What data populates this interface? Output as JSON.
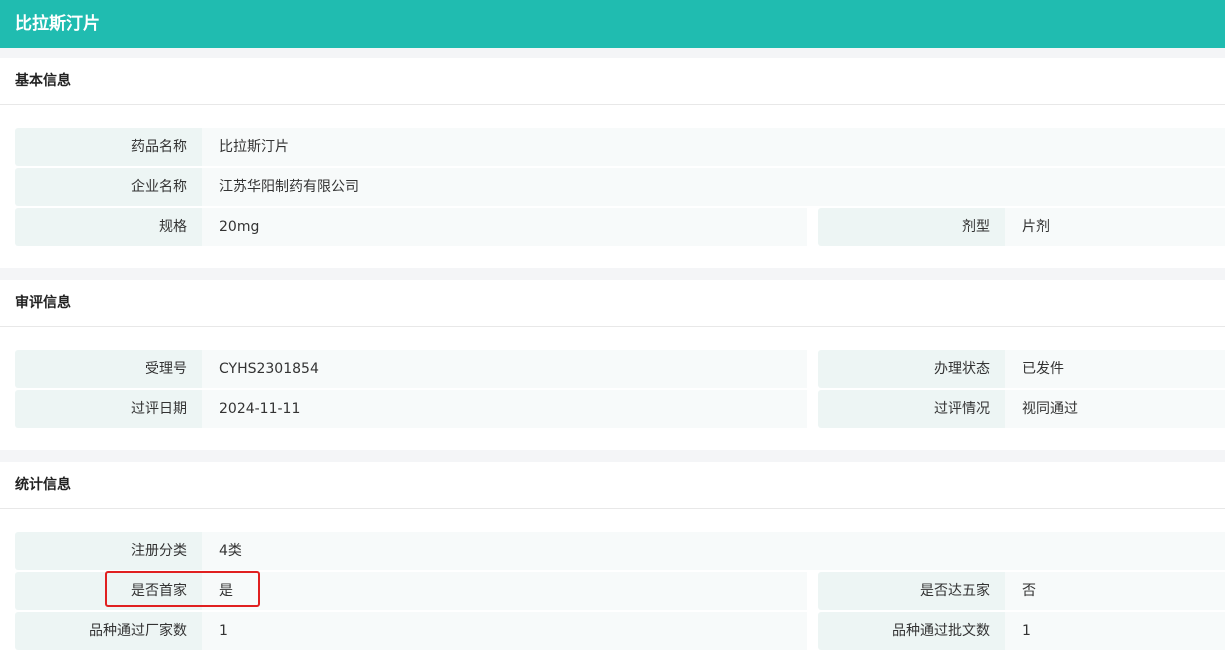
{
  "header": {
    "title": "比拉斯汀片"
  },
  "sections": [
    {
      "title": "基本信息",
      "rows": [
        [
          {
            "label": "药品名称",
            "value": "比拉斯汀片"
          }
        ],
        [
          {
            "label": "企业名称",
            "value": "江苏华阳制药有限公司"
          }
        ],
        [
          {
            "label": "规格",
            "value": "20mg"
          },
          {
            "label": "剂型",
            "value": "片剂"
          }
        ]
      ]
    },
    {
      "title": "审评信息",
      "rows": [
        [
          {
            "label": "受理号",
            "value": "CYHS2301854"
          },
          {
            "label": "办理状态",
            "value": "已发件"
          }
        ],
        [
          {
            "label": "过评日期",
            "value": "2024-11-11"
          },
          {
            "label": "过评情况",
            "value": "视同通过"
          }
        ]
      ]
    },
    {
      "title": "统计信息",
      "rows": [
        [
          {
            "label": "注册分类",
            "value": "4类"
          }
        ],
        [
          {
            "label": "是否首家",
            "value": "是"
          },
          {
            "label": "是否达五家",
            "value": "否"
          }
        ],
        [
          {
            "label": "品种通过厂家数",
            "value": "1"
          },
          {
            "label": "品种通过批文数",
            "value": "1"
          }
        ]
      ]
    }
  ]
}
